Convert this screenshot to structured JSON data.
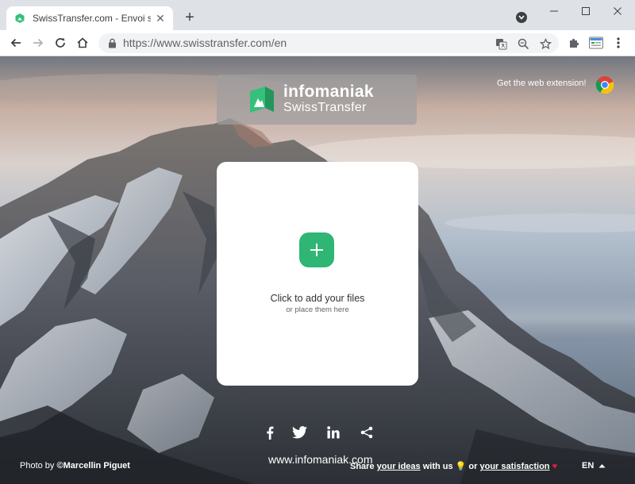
{
  "browser": {
    "tab": {
      "title": "SwissTransfer.com - Envoi sécu"
    },
    "url": "https://www.swisstransfer.com/en",
    "icons": [
      "favicon-icon",
      "tab-close-icon",
      "new-tab-icon",
      "tab-search-icon",
      "minimize-icon",
      "maximize-icon",
      "close-window-icon",
      "back-icon",
      "forward-icon",
      "reload-icon",
      "home-icon",
      "lock-icon",
      "translate-icon",
      "zoom-icon",
      "bookmark-star-icon",
      "extensions-icon",
      "profile-icon",
      "menu-icon"
    ]
  },
  "page": {
    "brand": {
      "name": "infomaniak",
      "product": "SwissTransfer"
    },
    "extension_link": "Get the web extension!",
    "upload": {
      "title": "Click to add your files",
      "subtitle": "or place them here"
    },
    "social": [
      "facebook-icon",
      "twitter-icon",
      "linkedin-icon",
      "share-icon"
    ],
    "footer": {
      "photo_prefix": "Photo by ",
      "photographer": "©Marcellin Piguet",
      "site": "www.infomaniak.com",
      "share_text": "Share ",
      "ideas_link": "your ideas",
      "with_us": " with us ",
      "or_text": " or ",
      "satisfaction_link": "your satisfaction",
      "language": "EN"
    },
    "colors": {
      "accent": "#2fb674",
      "brand_green": "#34c17a",
      "card": "#ffffff"
    }
  }
}
